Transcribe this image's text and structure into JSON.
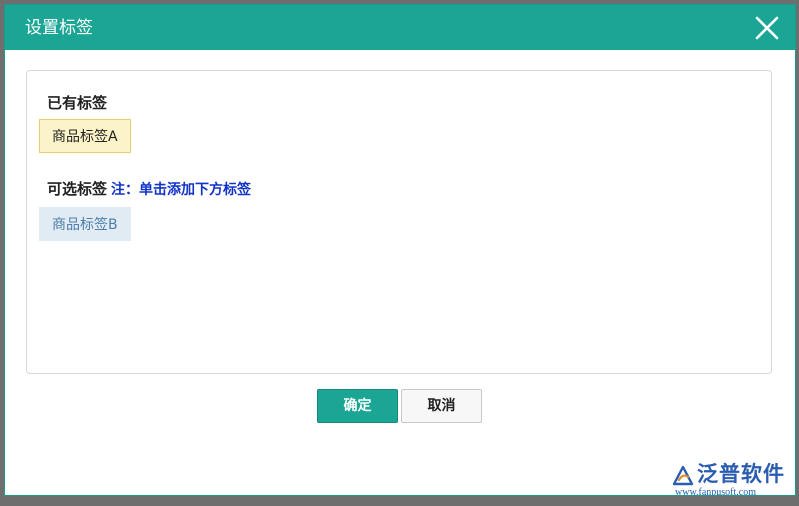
{
  "dialog": {
    "title": "设置标签",
    "close_icon": "close-icon"
  },
  "existing": {
    "heading": "已有标签",
    "tags": [
      "商品标签A"
    ]
  },
  "optional": {
    "heading": "可选标签",
    "note": "注：单击添加下方标签",
    "tags": [
      "商品标签B"
    ]
  },
  "buttons": {
    "confirm": "确定",
    "cancel": "取消"
  },
  "watermark": {
    "name": "泛普软件",
    "url": "www.fanpusoft.com"
  },
  "colors": {
    "accent": "#1aa595",
    "existing_tag_bg": "#fdf3c9",
    "option_tag_bg": "#e1ebf3",
    "note_text": "#1233c8"
  }
}
